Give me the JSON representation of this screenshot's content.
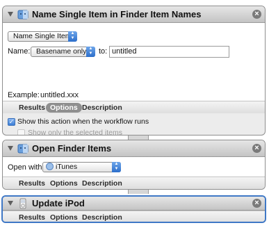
{
  "actions": [
    {
      "title": "Name Single Item in Finder Item Names",
      "mode_popup": "Name Single Item",
      "name_label": "Name:",
      "name_popup": "Basename only",
      "to_label": "to:",
      "to_value": "untitled",
      "example_label": "Example:",
      "example_value": "untitled.xxx",
      "tabs": [
        "Results",
        "Options",
        "Description"
      ],
      "active_tab": "Options",
      "show_action_label": "Show this action when the workflow runs",
      "show_action_checked": true,
      "show_selected_label": "Show only the selected items",
      "show_selected_checked": false
    },
    {
      "title": "Open Finder Items",
      "open_with_label": "Open with:",
      "open_with_value": "iTunes",
      "tabs": [
        "Results",
        "Options",
        "Description"
      ]
    },
    {
      "title": "Update iPod",
      "tabs": [
        "Results",
        "Options",
        "Description"
      ],
      "selected": true
    }
  ],
  "colors": {
    "selection_border": "#3f78c6",
    "popup_arrow_blue": "#2c6ecb",
    "active_tab": "#8f8f8f"
  },
  "icons": [
    "disclosure-triangle-icon",
    "finder-icon",
    "close-icon",
    "itunes-icon",
    "ipod-icon",
    "checkmark-icon"
  ]
}
